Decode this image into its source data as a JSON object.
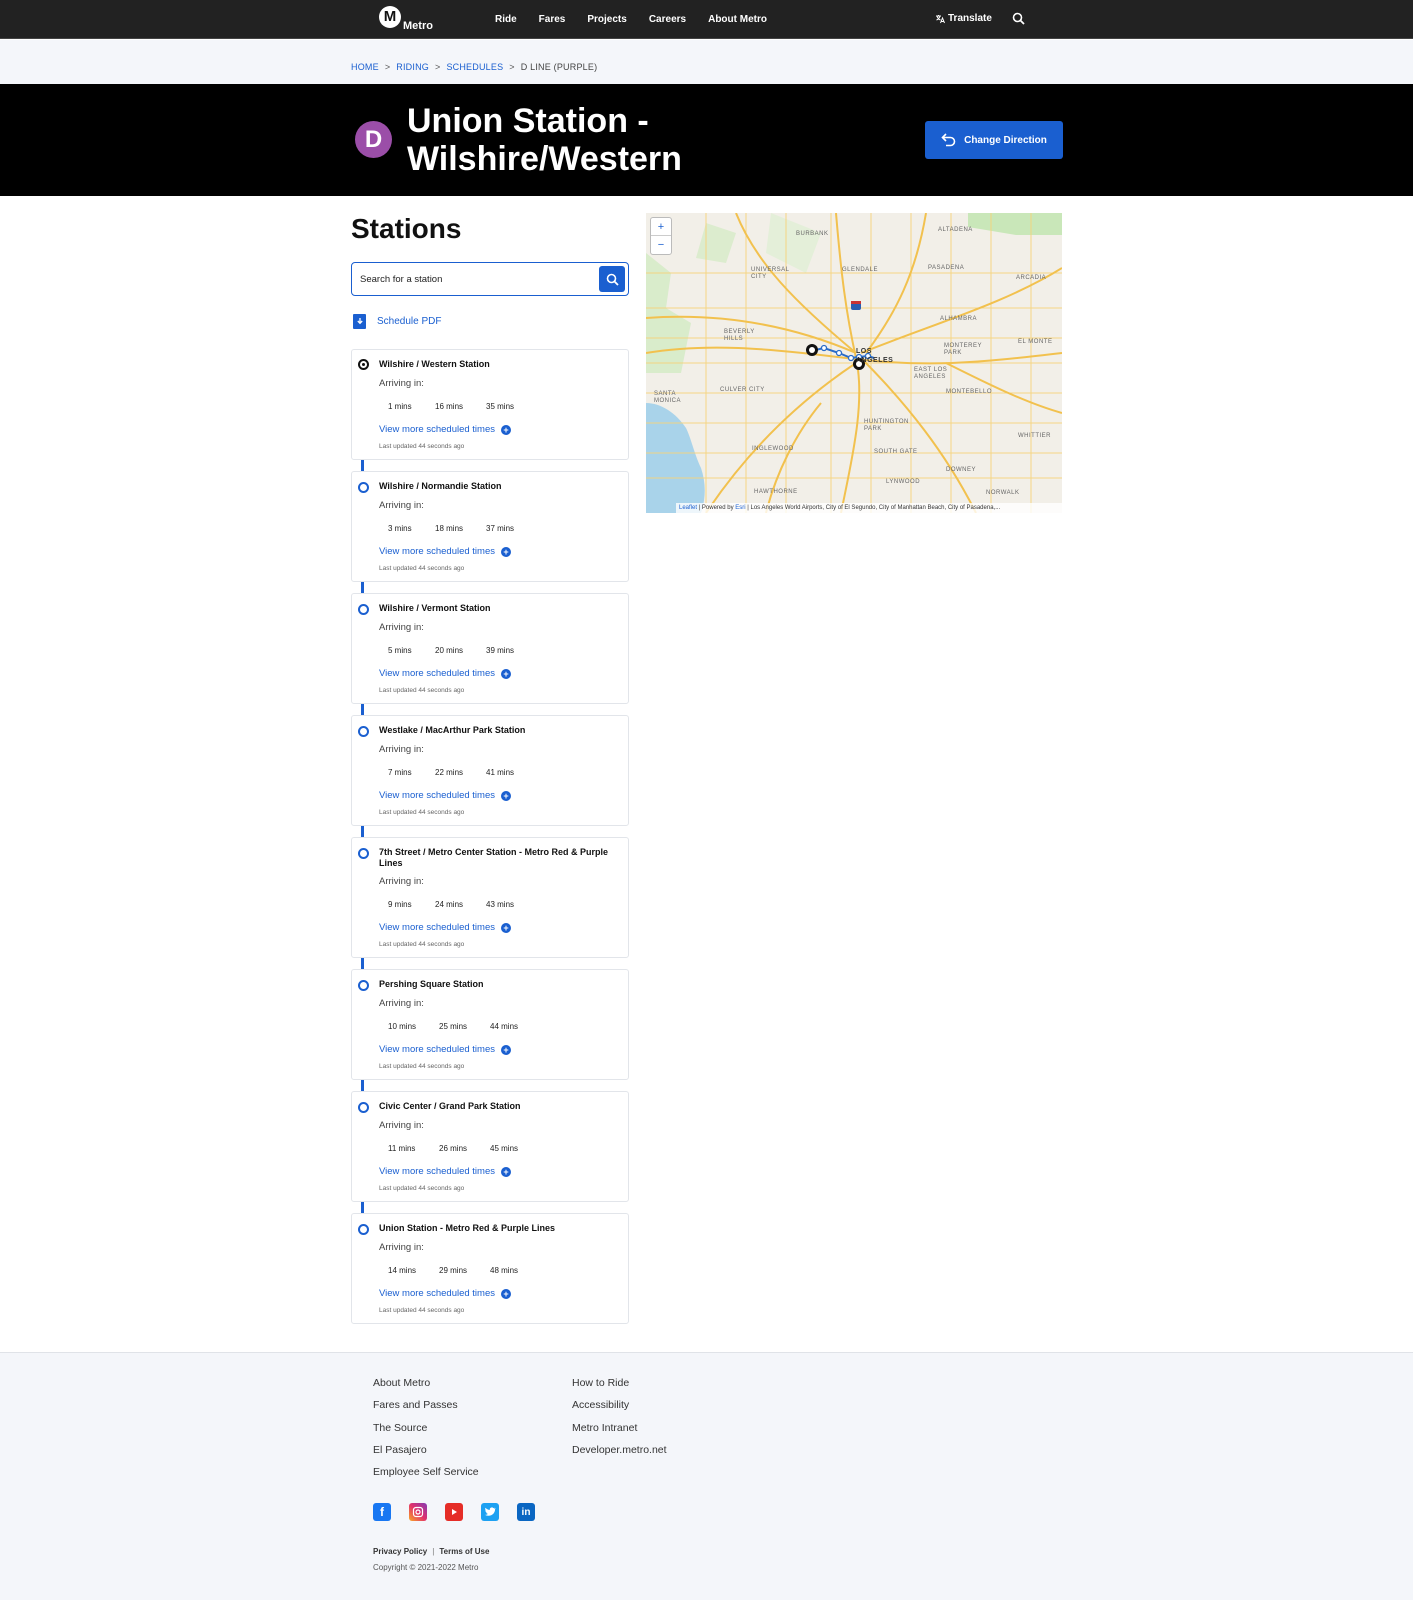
{
  "nav": {
    "logo_text": "Metro",
    "logo_letter": "M",
    "links": [
      "Ride",
      "Fares",
      "Projects",
      "Careers",
      "About Metro"
    ],
    "translate": "Translate"
  },
  "breadcrumb": {
    "items": [
      "HOME",
      "RIDING",
      "SCHEDULES"
    ],
    "current": "D LINE (PURPLE)"
  },
  "hero": {
    "line_letter": "D",
    "title": "Union Station - Wilshire/Western",
    "change_direction": "Change Direction"
  },
  "colors": {
    "accent": "#1a5fd0",
    "line_purple": "#9b4ea8"
  },
  "stations_section": {
    "title": "Stations",
    "search_placeholder": "Search for a station",
    "schedule_pdf": "Schedule PDF",
    "arriving_label": "Arriving in:",
    "more_label": "View more scheduled times",
    "updated_label": "Last updated 44 seconds ago"
  },
  "stations": [
    {
      "name": "Wilshire / Western Station",
      "times": [
        "1 mins",
        "16 mins",
        "35 mins"
      ]
    },
    {
      "name": "Wilshire / Normandie Station",
      "times": [
        "3 mins",
        "18 mins",
        "37 mins"
      ]
    },
    {
      "name": "Wilshire / Vermont Station",
      "times": [
        "5 mins",
        "20 mins",
        "39 mins"
      ]
    },
    {
      "name": "Westlake / MacArthur Park Station",
      "times": [
        "7 mins",
        "22 mins",
        "41 mins"
      ]
    },
    {
      "name": "7th Street / Metro Center Station - Metro Red & Purple Lines",
      "times": [
        "9 mins",
        "24 mins",
        "43 mins"
      ]
    },
    {
      "name": "Pershing Square Station",
      "times": [
        "10 mins",
        "25 mins",
        "44 mins"
      ]
    },
    {
      "name": "Civic Center / Grand Park Station",
      "times": [
        "11 mins",
        "26 mins",
        "45 mins"
      ]
    },
    {
      "name": "Union Station - Metro Red & Purple Lines",
      "times": [
        "14 mins",
        "29 mins",
        "48 mins"
      ]
    }
  ],
  "map": {
    "zoom_in": "+",
    "zoom_out": "−",
    "attribution_leaflet": "Leaflet",
    "attribution_mid": " | Powered by ",
    "attribution_esri": "Esri",
    "attribution_rest": " | Los Angeles World Airports, City of El Segundo, City of Manhattan Beach, City of Pasadena,...",
    "labels": [
      "BURBANK",
      "GLENDALE",
      "PASADENA",
      "ALTADENA",
      "ARCADIA",
      "UNIVERSAL CITY",
      "ALHAMBRA",
      "BEVERLY HILLS",
      "MONTEREY PARK",
      "EL MONTE",
      "LOS ANGELES",
      "SANTA MONICA",
      "CULVER CITY",
      "EAST LOS ANGELES",
      "MONTEBELLO",
      "HUNTINGTON PARK",
      "INGLEWOOD",
      "SOUTH GATE",
      "WHITTIER",
      "DOWNEY",
      "LYNWOOD",
      "HAWTHORNE",
      "NORWALK"
    ]
  },
  "footer": {
    "col1": [
      "About Metro",
      "Fares and Passes",
      "The Source",
      "El Pasajero",
      "Employee Self Service"
    ],
    "col2": [
      "How to Ride",
      "Accessibility",
      "Metro Intranet",
      "Developer.metro.net"
    ],
    "social": [
      "facebook-icon",
      "instagram-icon",
      "youtube-icon",
      "twitter-icon",
      "linkedin-icon"
    ],
    "privacy": "Privacy Policy",
    "terms": "Terms of Use",
    "copyright": "Copyright © 2021-2022 Metro"
  }
}
